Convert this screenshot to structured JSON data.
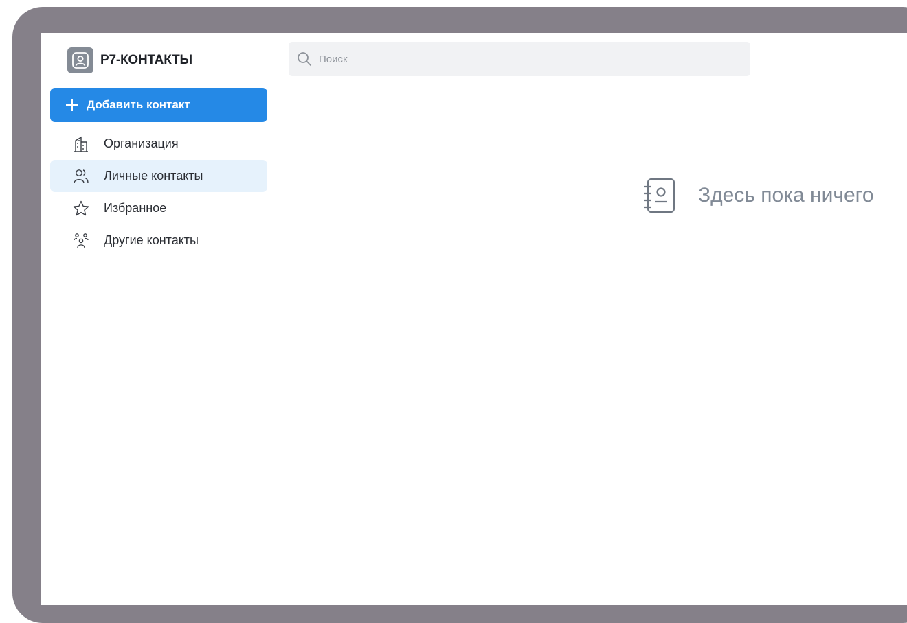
{
  "app": {
    "title": "Р7-КОНТАКТЫ"
  },
  "search": {
    "placeholder": "Поиск",
    "value": ""
  },
  "sidebar": {
    "add_button": {
      "label": "Добавить контакт"
    },
    "items": [
      {
        "label": "Организация",
        "icon": "building-icon",
        "active": false
      },
      {
        "label": "Личные контакты",
        "icon": "users-icon",
        "active": true
      },
      {
        "label": "Избранное",
        "icon": "star-icon",
        "active": false
      },
      {
        "label": "Другие контакты",
        "icon": "group-icon",
        "active": false
      }
    ]
  },
  "main": {
    "empty_state": {
      "text": "Здесь пока ничего",
      "icon": "address-book-icon"
    }
  },
  "colors": {
    "accent": "#2589e6",
    "active_item_bg": "#e6f2fc",
    "frame": "#858089",
    "muted_text": "#818a96"
  }
}
